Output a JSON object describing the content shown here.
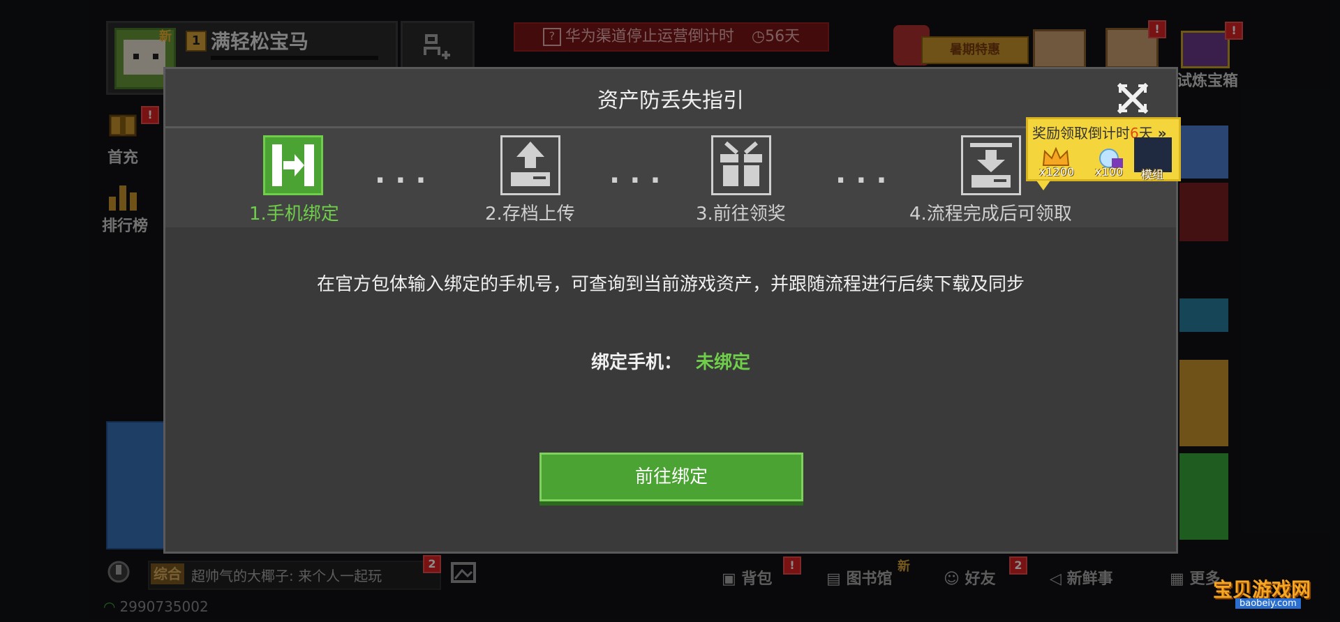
{
  "background": {
    "profile": {
      "new_tag": "新",
      "level": "1",
      "username": "满轻松宝马"
    },
    "notice": {
      "icon": "question-box-icon",
      "text": "华为渠道停止运营倒计时",
      "countdown": "56天"
    },
    "top_right": {
      "promo_label": "暑期特惠",
      "chest_label": "试炼宝箱",
      "badge": "!"
    },
    "left_side": {
      "first_charge": "首充",
      "ranking": "排行榜"
    },
    "bottom_bar": {
      "chat_channel": "综合",
      "chat_message": "超帅气的大椰子: 来个人一起玩",
      "chat_badge": "2",
      "backpack": "背包",
      "library": "图书馆",
      "library_tag": "新",
      "friends": "好友",
      "friends_badge": "2",
      "news": "新鲜事",
      "more": "更多",
      "alert": "!"
    },
    "network": {
      "player_id": "2990735002"
    },
    "watermark": {
      "main": "宝贝游戏网",
      "sub": "baobeiy.com"
    }
  },
  "modal": {
    "title": "资产防丢失指引",
    "steps": [
      {
        "label": "1.手机绑定",
        "icon": "phone-bind-icon",
        "active": true
      },
      {
        "label": "2.存档上传",
        "icon": "upload-icon",
        "active": false
      },
      {
        "label": "3.前往领奖",
        "icon": "gift-icon",
        "active": false
      },
      {
        "label": "4.流程完成后可领取",
        "icon": "download-icon",
        "active": false
      }
    ],
    "step_separator": "...",
    "description": "在官方包体输入绑定的手机号，可查询到当前游戏资产，并跟随流程进行后续下载及同步",
    "bind_label": "绑定手机：",
    "bind_status": "未绑定",
    "action_button": "前往绑定"
  },
  "reward_popup": {
    "title_prefix": "奖励领取倒计时",
    "days": "6",
    "title_suffix": "天",
    "items": [
      {
        "icon": "crown-icon",
        "qty": "x1200"
      },
      {
        "icon": "gem-bound-icon",
        "qty": "x100"
      },
      {
        "icon": "mod-icon",
        "qty": "模组"
      }
    ]
  },
  "colors": {
    "accent_green": "#6fcf4a",
    "button_green": "#4aa332",
    "notice_red": "#7a1414",
    "reward_yellow": "#f4d63c"
  }
}
